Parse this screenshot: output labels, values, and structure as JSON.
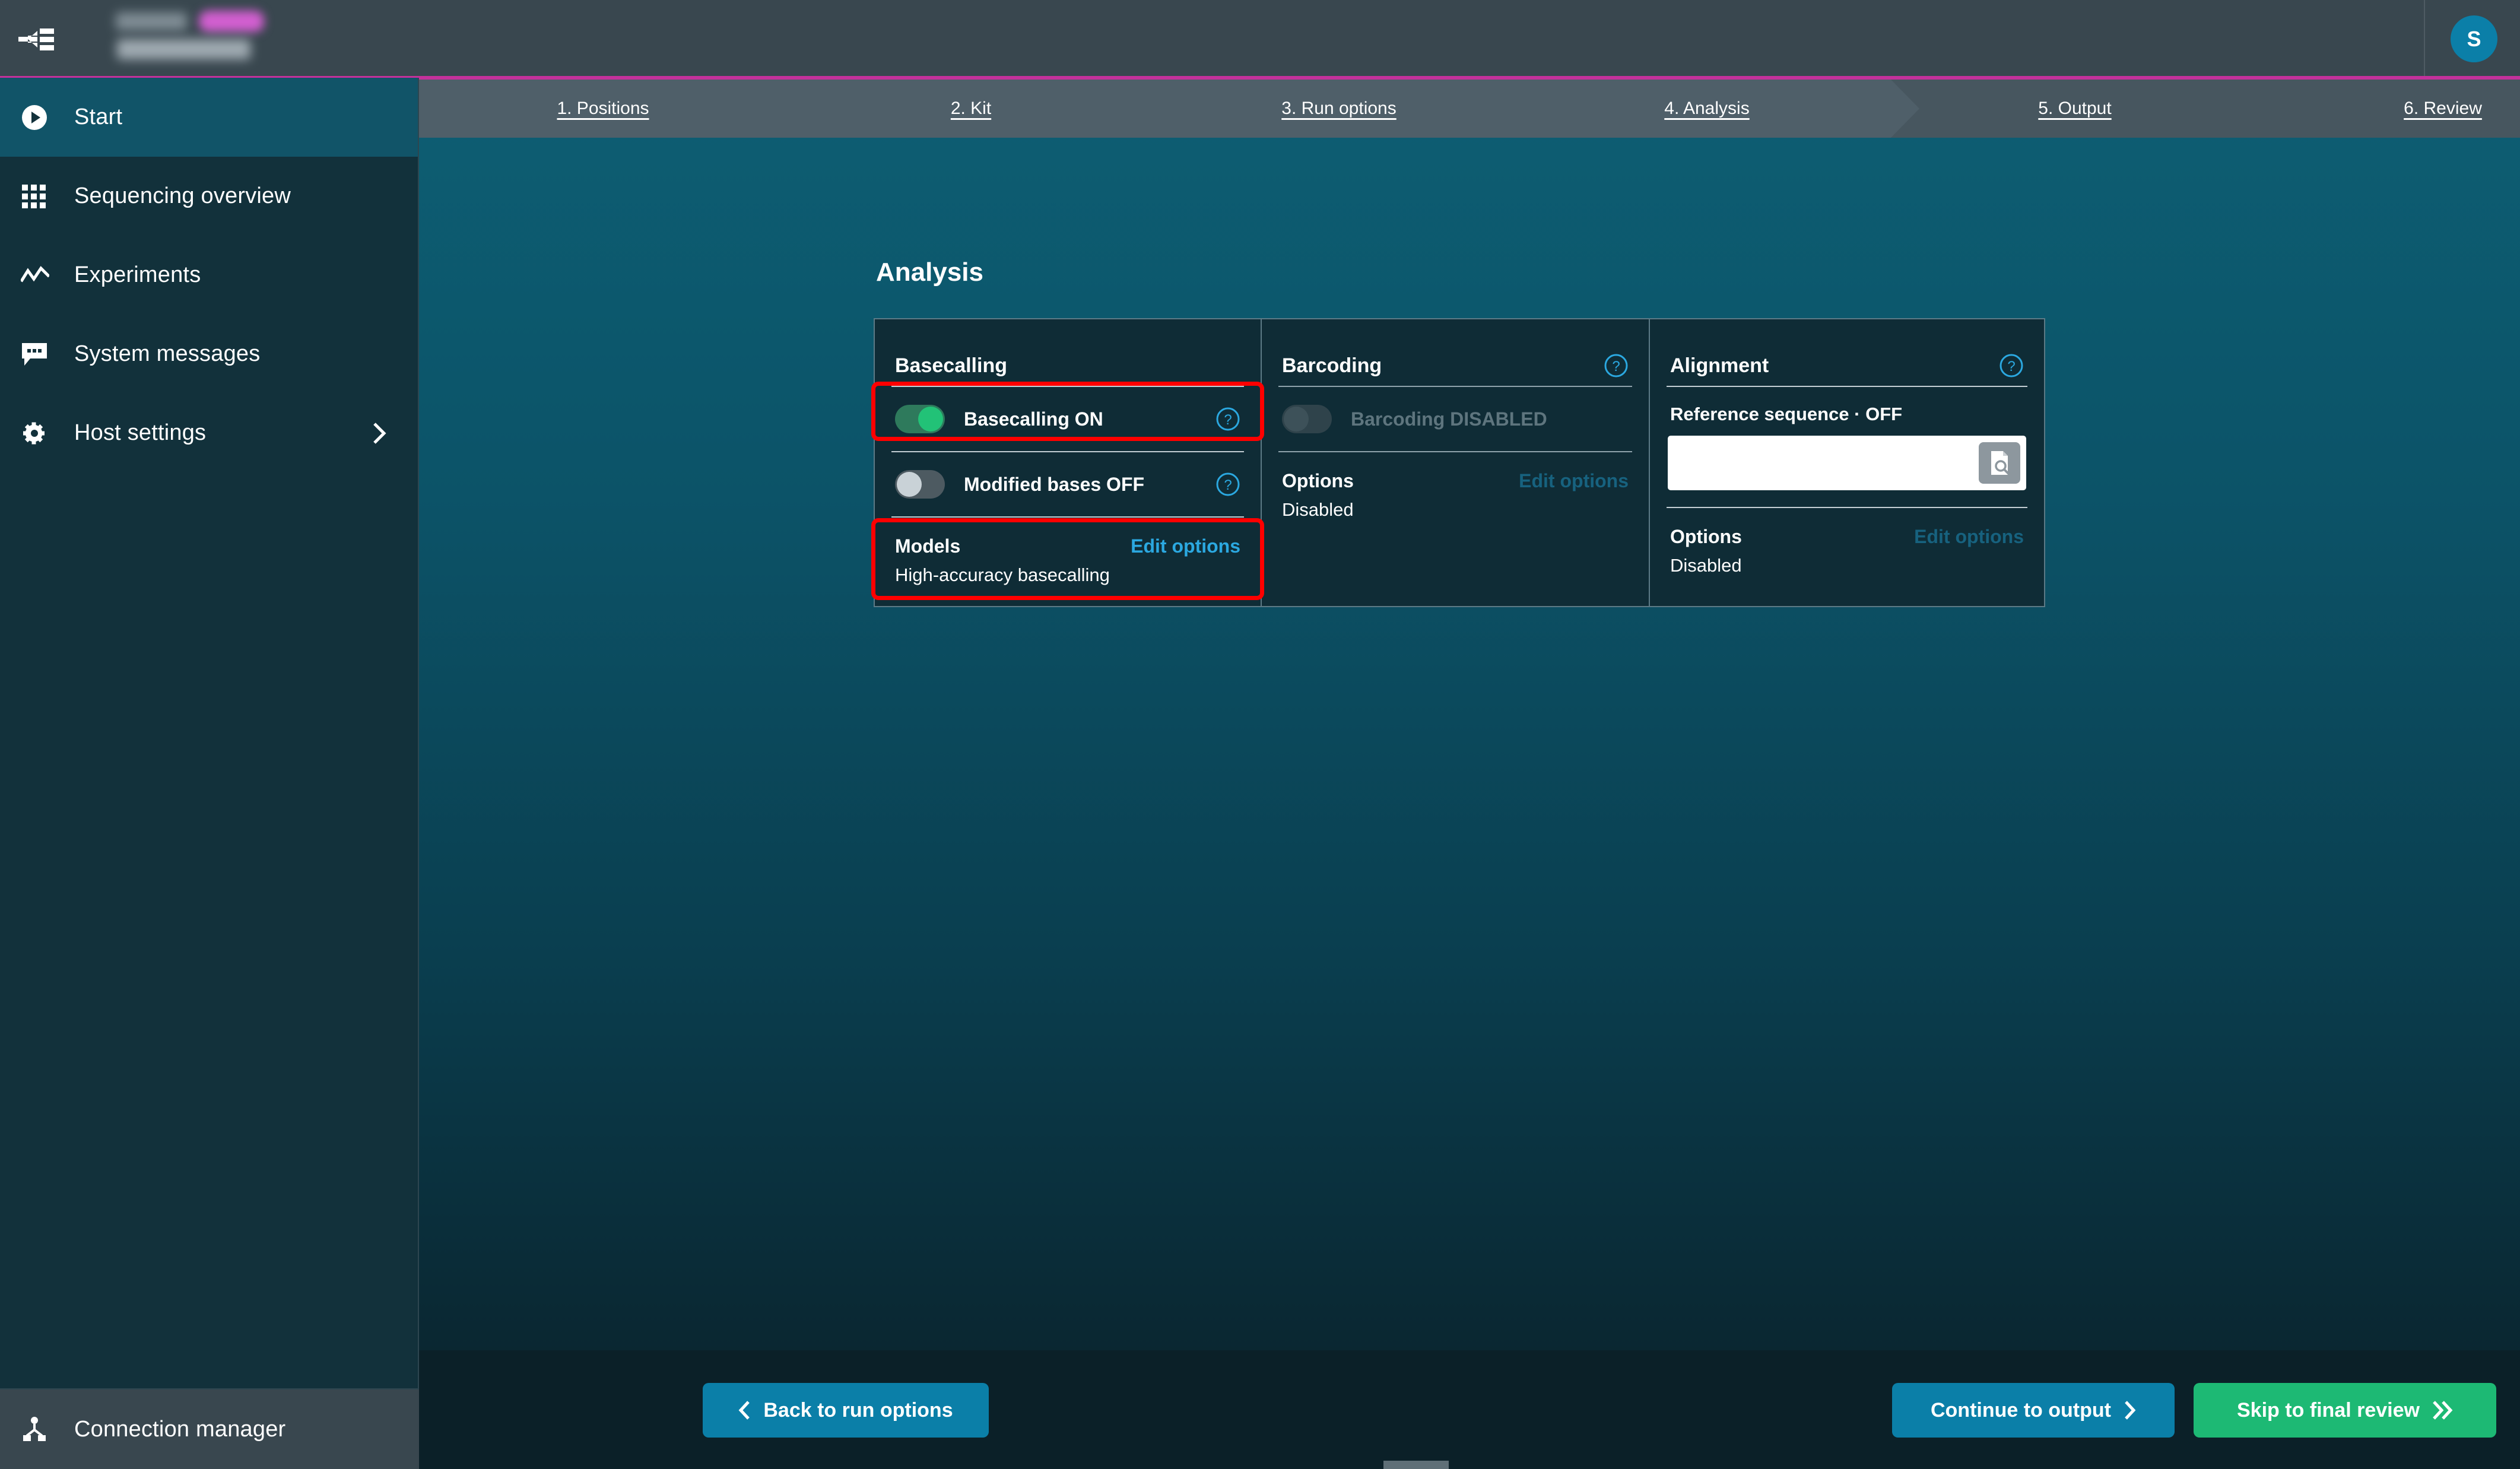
{
  "topbar": {
    "collapse_icon": "collapse-sidebar-icon",
    "brand_redacted": true,
    "avatar_initial": "S"
  },
  "sidebar": {
    "items": [
      {
        "label": "Start",
        "icon": "play-circle-icon",
        "active": true,
        "chevron": false
      },
      {
        "label": "Sequencing overview",
        "icon": "grid-icon",
        "active": false,
        "chevron": false
      },
      {
        "label": "Experiments",
        "icon": "line-chart-icon",
        "active": false,
        "chevron": false
      },
      {
        "label": "System messages",
        "icon": "message-icon",
        "active": false,
        "chevron": false
      },
      {
        "label": "Host settings",
        "icon": "gear-icon",
        "active": false,
        "chevron": true
      }
    ],
    "footer": {
      "label": "Connection manager",
      "icon": "network-node-icon"
    }
  },
  "stepper": {
    "steps": [
      {
        "label": "1. Positions",
        "active": false
      },
      {
        "label": "2. Kit",
        "active": false
      },
      {
        "label": "3. Run options",
        "active": false
      },
      {
        "label": "4. Analysis",
        "active": true
      },
      {
        "label": "5. Output",
        "active": false
      },
      {
        "label": "6. Review",
        "active": false
      }
    ]
  },
  "main": {
    "page_title": "Analysis",
    "cards": {
      "basecalling": {
        "title": "Basecalling",
        "toggles": [
          {
            "label": "Basecalling ON",
            "state": "on",
            "help": true,
            "highlighted": true
          },
          {
            "label": "Modified bases OFF",
            "state": "off",
            "help": true,
            "highlighted": false
          }
        ],
        "models": {
          "title": "Models",
          "edit_label": "Edit options",
          "value": "High-accuracy basecalling",
          "highlighted": true
        }
      },
      "barcoding": {
        "title": "Barcoding",
        "help": true,
        "toggle": {
          "label": "Barcoding DISABLED",
          "state": "disabled"
        },
        "options": {
          "title": "Options",
          "edit_label": "Edit options",
          "edit_disabled": true,
          "value": "Disabled"
        }
      },
      "alignment": {
        "title": "Alignment",
        "help": true,
        "reference_label": "Reference sequence · OFF",
        "reference_value": "",
        "reference_placeholder": "",
        "browse_icon": "file-search-icon",
        "options": {
          "title": "Options",
          "edit_label": "Edit options",
          "edit_disabled": true,
          "value": "Disabled"
        }
      }
    }
  },
  "footer": {
    "back_label": "Back to run options",
    "continue_label": "Continue to output",
    "skip_label": "Skip to final review"
  },
  "colors": {
    "accent_blue": "#0b7fa8",
    "accent_green": "#1db974",
    "accent_pink": "#c4319b",
    "link_blue": "#2ba8e0",
    "highlight_red": "#ff0000",
    "sidebar_bg": "#12313b",
    "topbar_bg": "#39474f",
    "card_bg": "#0f2c36"
  }
}
